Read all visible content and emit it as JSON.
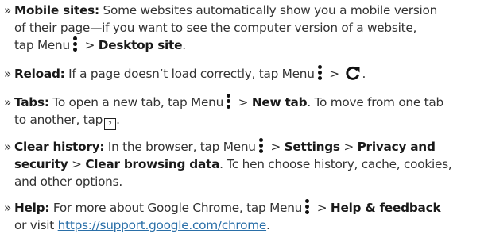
{
  "bullet": "»",
  "items": [
    {
      "lines": [
        [
          "Mobile sites:",
          " Some websites automatically show you a mobile version"
        ],
        [
          "of their page—if you want to see the computer version of a website,"
        ],
        [
          "tap Menu",
          " > ",
          "Desktop site",
          "."
        ]
      ]
    },
    {
      "lines": [
        [
          "Reload:",
          " If a page doesn’t load correctly, tap Menu",
          " > ",
          "."
        ]
      ]
    },
    {
      "lines": [
        [
          "Tabs:",
          " To open a new tab, tap Menu",
          " > ",
          "New tab",
          ". To move from one tab"
        ],
        [
          "to another, tap",
          "2",
          "."
        ]
      ]
    },
    {
      "lines": [
        [
          "Clear history:",
          " In the browser, tap Menu",
          " > ",
          "Settings",
          " > ",
          "Privacy and"
        ],
        [
          "security",
          " > ",
          "Clear browsing data",
          ". Tc hen choose history, cache, cookies,"
        ],
        [
          "and other options."
        ]
      ]
    },
    {
      "lines": [
        [
          "Help:",
          " For more about Google Chrome, tap Menu",
          " > ",
          "Help & feedback"
        ],
        [
          "or visit ",
          "https://support.google.com/chrome",
          "."
        ]
      ]
    }
  ],
  "icons": {
    "menu": "three-dot-menu-icon",
    "reload": "reload-icon",
    "tabs": "tab-count-icon"
  },
  "colors": {
    "text": "#333333",
    "bold": "#1a1a1a",
    "link": "#2a6fa8"
  }
}
